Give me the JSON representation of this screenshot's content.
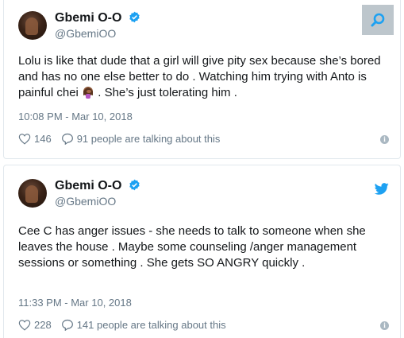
{
  "tweets": [
    {
      "name": "Gbemi O-O",
      "handle": "@GbemiOO",
      "text_before_emoji": "Lolu is like that dude that a girl will give pity sex because she’s bored and has no one else better to do . Watching him trying with Anto is painful chei ",
      "emoji": "facepalm-woman-emoji",
      "text_after_emoji": ". She’s just tolerating him .",
      "time": "10:08 PM - Mar 10, 2018",
      "likes": "146",
      "talking": "91 people are talking about this"
    },
    {
      "name": "Gbemi O-O",
      "handle": "@GbemiOO",
      "text": "Cee C has anger issues - she needs to talk to someone when she leaves the house . Maybe some counseling /anger management sessions or something . She gets SO ANGRY quickly .",
      "time": "11:33 PM - Mar 10, 2018",
      "likes": "228",
      "talking": "141 people are talking about this"
    }
  ],
  "colors": {
    "accent": "#1da1f2",
    "muted": "#657786",
    "border": "#e1e8ed",
    "search_bg": "#bdc6cc"
  },
  "icons": {
    "verified": "verified-badge-icon",
    "bird": "twitter-bird-icon",
    "like": "heart-icon",
    "reply": "comment-icon",
    "info": "info-icon",
    "search": "search-icon"
  }
}
